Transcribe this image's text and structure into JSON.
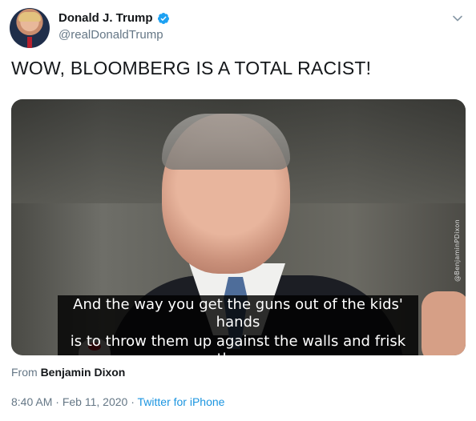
{
  "tweet": {
    "author": {
      "display_name": "Donald J. Trump",
      "handle": "@realDonaldTrump",
      "verified": true,
      "verified_icon": "verified-badge-icon"
    },
    "menu_icon": "chevron-down-icon",
    "text": "WOW, BLOOMBERG IS A TOTAL RACIST!",
    "media": {
      "captions": [
        "And the way you get the guns out of the kids' hands",
        "is to throw them up against the walls and frisk them."
      ],
      "watermark": "@BenjaminPDixon"
    },
    "attribution": {
      "prefix": "From",
      "source": "Benjamin Dixon"
    },
    "time": "8:40 AM",
    "date": "Feb 11, 2020",
    "separator": "·",
    "client": "Twitter for iPhone"
  },
  "colors": {
    "link_blue": "#1b95e0",
    "verified_blue": "#1da1f2",
    "muted_gray": "#657786",
    "text_dark": "#14171a"
  }
}
